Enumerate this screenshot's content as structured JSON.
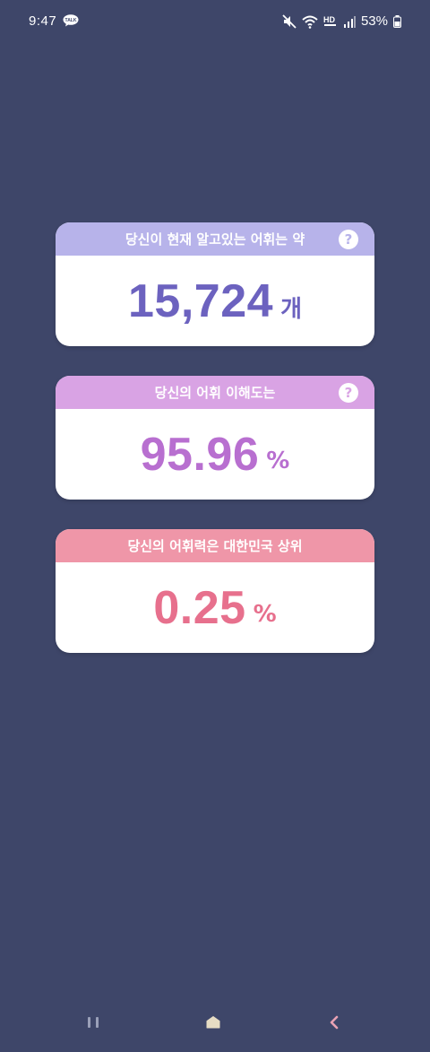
{
  "status_bar": {
    "time": "9:47",
    "battery": "53%",
    "icons": [
      "kakaotalk-icon",
      "mute-icon",
      "wifi-icon",
      "hd-icon",
      "signal-icon",
      "battery-icon"
    ]
  },
  "cards": {
    "vocab": {
      "title": "당신이 현재 알고있는 어휘는 약",
      "value": "15,724",
      "unit": "개",
      "help": "?",
      "colors": {
        "header": "#b7b3ea",
        "value": "#6c62bf"
      }
    },
    "comprehension": {
      "title": "당신의 어휘 이해도는",
      "value": "95.96",
      "unit": "%",
      "help": "?",
      "colors": {
        "header": "#d9a3e4",
        "value": "#b86fd0"
      }
    },
    "rank": {
      "title": "당신의 어휘력은 대한민국 상위",
      "value": "0.25",
      "unit": "%",
      "colors": {
        "header": "#ef96a8",
        "value": "#e7708d"
      }
    }
  },
  "nav_bar": {
    "buttons": [
      "recents-icon",
      "home-icon",
      "back-icon"
    ]
  },
  "theme": {
    "background": "#3e4669"
  }
}
